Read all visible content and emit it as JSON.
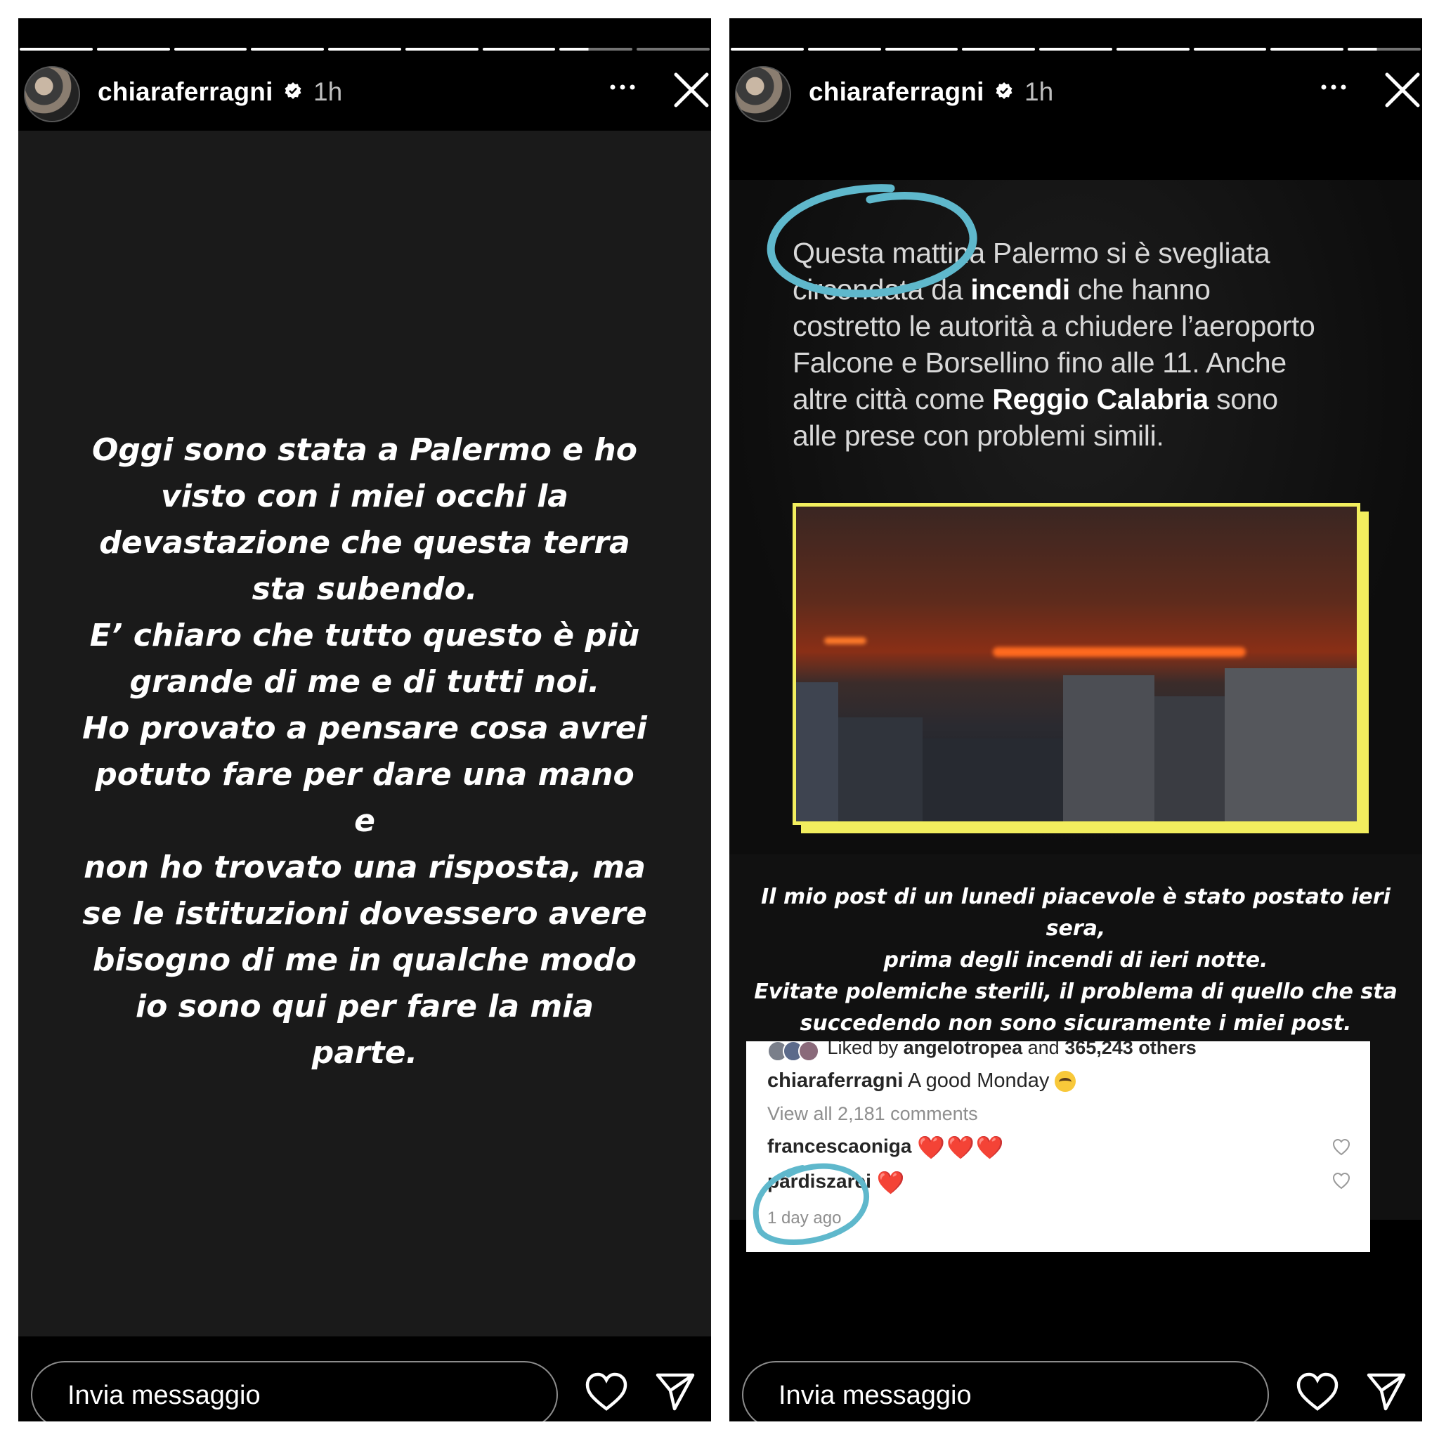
{
  "colors": {
    "story_bg": "#1a1a1a",
    "highlight_yellow": "#f2ee5e",
    "annotation_blue": "#5fb8cc",
    "like_red": "#e0262f"
  },
  "left_story": {
    "username": "chiaraferragni",
    "time": "1h",
    "text": "Oggi sono stata a Palermo e ho\nvisto con i miei occhi la\ndevastazione che questa terra\nsta subendo.\nE’ chiaro che tutto questo è più\ngrande di me e di tutti noi.\nHo provato a pensare cosa avrei\npotuto fare per dare una mano e\nnon ho trovato una risposta, ma\nse le istituzioni dovessero avere\nbisogno di me in qualche modo\nio sono qui per fare la mia\nparte.",
    "message_placeholder": "Invia messaggio",
    "icons": [
      "verified-badge-icon",
      "more-options-icon",
      "close-icon",
      "heart-icon",
      "send-icon"
    ]
  },
  "right_story": {
    "username": "chiaraferragni",
    "time": "1h",
    "news": {
      "line1_a": "Questa mattina Palermo si è svegliata",
      "line2_a": "circondata da ",
      "line2_b": "incendi",
      "line2_c": " che hanno",
      "line3": "costretto le autorità a chiudere l’aeroporto",
      "line4": "Falcone e Borsellino fino alle 11. Anche",
      "line5_a": "altre città come ",
      "line5_b": "Reggio Calabria",
      "line5_c": " sono",
      "line6": "alle prese con problemi simili."
    },
    "overlay_text": "Il mio post di un lunedi piacevole è stato postato ieri sera,\nprima degli incendi di ieri notte.\nEvitate polemiche sterili, il problema di quello che sta\nsuccedendo non sono sicuramente i miei post.",
    "post": {
      "liked_by_prefix": "Liked by ",
      "liked_by_user": "angelotropea",
      "liked_by_mid": " and ",
      "liked_by_count": "365,243 others",
      "caption_user": "chiaraferragni",
      "caption_text": " A good Monday",
      "view_comments": "View all 2,181 comments",
      "comments": [
        {
          "user": "francescaoniga",
          "hearts": "❤️❤️❤️"
        },
        {
          "user": "pardiszarei",
          "hearts": "❤️"
        }
      ],
      "timestamp": "1 day ago"
    },
    "message_placeholder": "Invia messaggio"
  }
}
